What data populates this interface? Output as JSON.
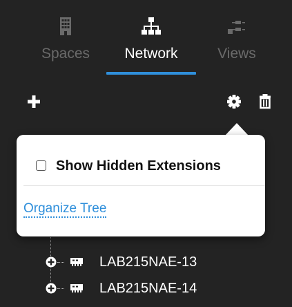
{
  "tabs": [
    {
      "label": "Spaces",
      "icon": "building-icon",
      "active": false
    },
    {
      "label": "Network",
      "icon": "network-icon",
      "active": true
    },
    {
      "label": "Views",
      "icon": "views-icon",
      "active": false
    }
  ],
  "toolbar": {
    "add_icon": "plus-icon",
    "settings_icon": "gear-icon",
    "delete_icon": "trash-icon"
  },
  "popover": {
    "checkbox_label": "Show Hidden Extensions",
    "checkbox_checked": false,
    "link_label": "Organize Tree"
  },
  "tree": {
    "items": [
      {
        "label": "LAB215NAE-13",
        "expander": "plus",
        "icon": "device-icon"
      },
      {
        "label": "LAB215NAE-14",
        "expander": "plus",
        "icon": "device-icon"
      }
    ]
  },
  "colors": {
    "background": "#232323",
    "accent": "#2f8fdb",
    "tab_inactive": "#6a6a6a",
    "text": "#ffffff"
  }
}
